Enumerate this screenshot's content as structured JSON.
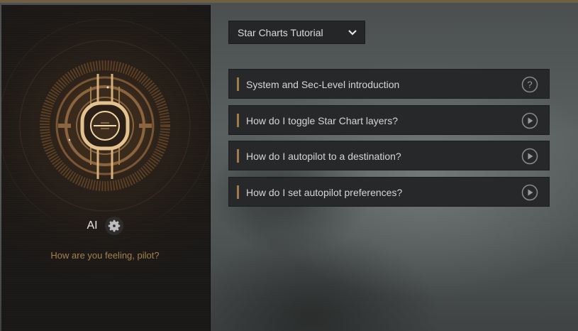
{
  "ai": {
    "name": "AI",
    "greeting": "How are you feeling, pilot?"
  },
  "tutorial_dropdown": {
    "selected": "Star Charts Tutorial"
  },
  "tutorials": [
    {
      "label": "System and Sec-Level introduction",
      "icon": "question-icon"
    },
    {
      "label": "How do I toggle Star Chart layers?",
      "icon": "play-icon"
    },
    {
      "label": "How do I autopilot to a destination?",
      "icon": "play-icon"
    },
    {
      "label": "How do I set autopilot preferences?",
      "icon": "play-icon"
    }
  ],
  "colors": {
    "accent": "#a27b4b",
    "greeting_text": "#a3814d",
    "panel_bg": "#262829"
  }
}
